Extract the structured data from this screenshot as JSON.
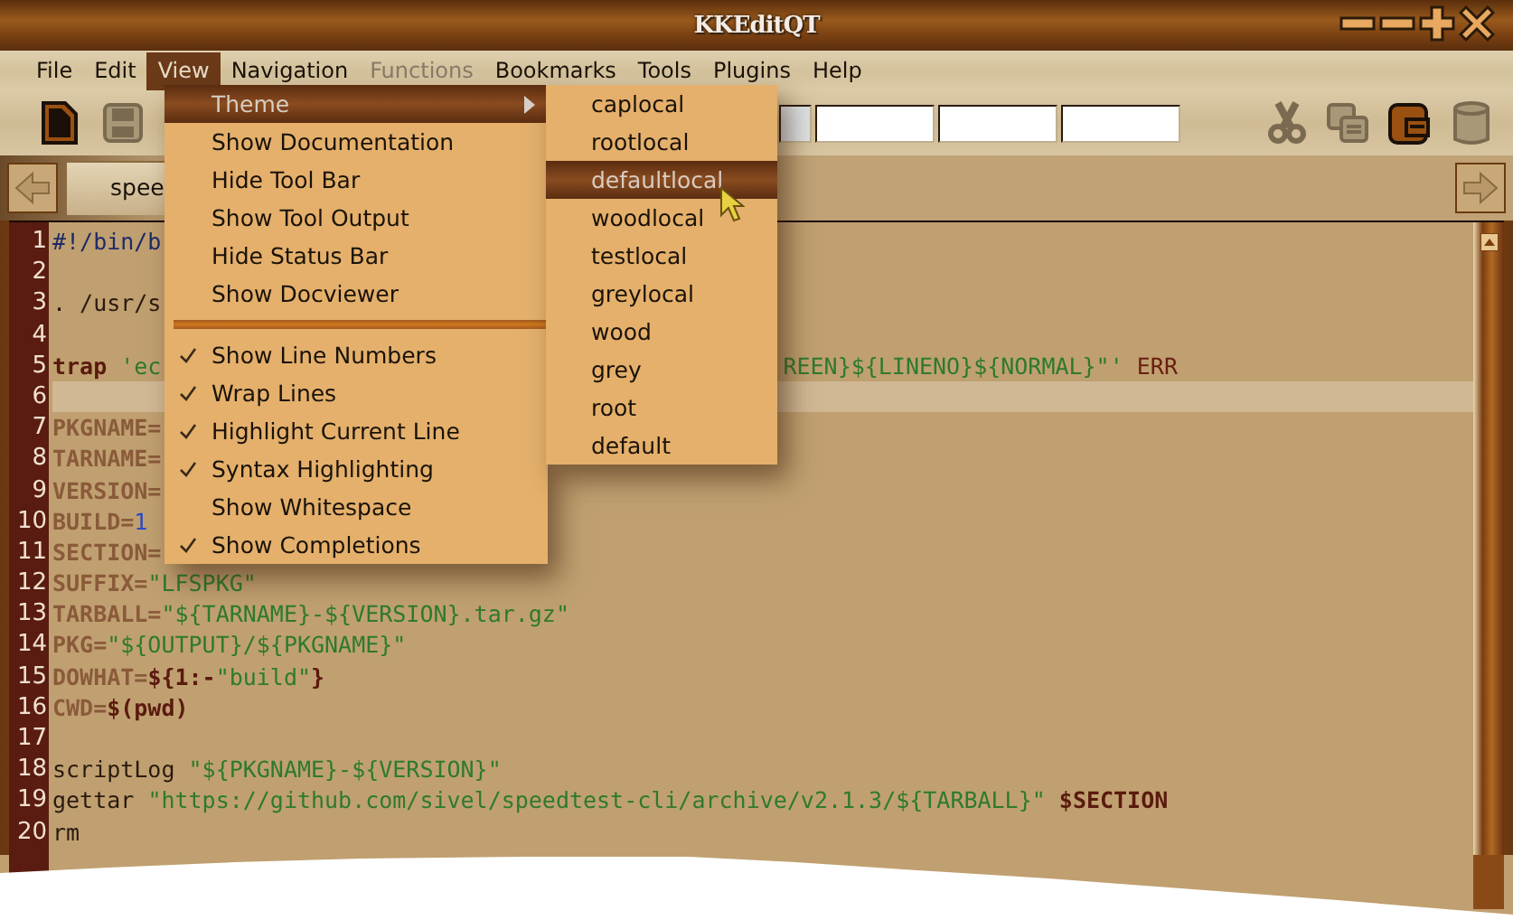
{
  "window": {
    "title": "KKEditQT"
  },
  "menubar": [
    {
      "label": "File",
      "selected": false,
      "disabled": false
    },
    {
      "label": "Edit",
      "selected": false,
      "disabled": false
    },
    {
      "label": "View",
      "selected": true,
      "disabled": false
    },
    {
      "label": "Navigation",
      "selected": false,
      "disabled": false
    },
    {
      "label": "Functions",
      "selected": false,
      "disabled": true
    },
    {
      "label": "Bookmarks",
      "selected": false,
      "disabled": false
    },
    {
      "label": "Tools",
      "selected": false,
      "disabled": false
    },
    {
      "label": "Plugins",
      "selected": false,
      "disabled": false
    },
    {
      "label": "Help",
      "selected": false,
      "disabled": false
    }
  ],
  "toolbar_left": [
    {
      "kind": "new",
      "disabled": false
    },
    {
      "kind": "save",
      "disabled": true
    }
  ],
  "toolbar_right": [
    {
      "kind": "cut",
      "disabled": true
    },
    {
      "kind": "copy",
      "disabled": true
    },
    {
      "kind": "paste",
      "disabled": false
    },
    {
      "kind": "delete",
      "disabled": true
    }
  ],
  "tabs": [
    {
      "label": "spee",
      "selected": true
    }
  ],
  "editor": {
    "lines": [
      {
        "number": "1",
        "current": false,
        "segments": [
          [
            {
              "kind": "comment",
              "text": "#!/bin/b"
            }
          ]
        ]
      },
      {
        "number": "2",
        "current": false
      },
      {
        "number": "3",
        "current": false,
        "segments": [
          [
            {
              "kind": "plain",
              "text": ". /usr/s"
            }
          ]
        ]
      },
      {
        "number": "4",
        "current": false
      },
      {
        "number": "5",
        "current": false,
        "segments": [
          [
            {
              "kind": "keyword",
              "text": "trap"
            },
            {
              "kind": "string",
              "text": " 'ec"
            }
          ],
          [
            {
              "kind": "string",
              "text": "REEN}${LINENO}${NORMAL}\"'"
            },
            {
              "kind": "word",
              "text": " ERR"
            }
          ]
        ]
      },
      {
        "number": "6",
        "current": true
      },
      {
        "number": "7",
        "current": false,
        "segments": [
          [
            {
              "kind": "var",
              "text": "PKGNAME="
            }
          ]
        ]
      },
      {
        "number": "8",
        "current": false,
        "segments": [
          [
            {
              "kind": "var",
              "text": "TARNAME="
            }
          ]
        ]
      },
      {
        "number": "9",
        "current": false,
        "segments": [
          [
            {
              "kind": "var",
              "text": "VERSION="
            }
          ]
        ]
      },
      {
        "number": "10",
        "current": false,
        "segments": [
          [
            {
              "kind": "var",
              "text": "BUILD="
            },
            {
              "kind": "number",
              "text": "1"
            }
          ]
        ]
      },
      {
        "number": "11",
        "current": false,
        "segments": [
          [
            {
              "kind": "var",
              "text": "SECTION="
            }
          ]
        ]
      },
      {
        "number": "12",
        "current": false,
        "segments": [
          [
            {
              "kind": "var",
              "text": "SUFFIX="
            },
            {
              "kind": "string",
              "text": "\"LFSPKG\""
            }
          ]
        ]
      },
      {
        "number": "13",
        "current": false,
        "segments": [
          [
            {
              "kind": "var",
              "text": "TARBALL="
            },
            {
              "kind": "string",
              "text": "\"${TARNAME}-${VERSION}.tar.gz\""
            }
          ]
        ]
      },
      {
        "number": "14",
        "current": false,
        "segments": [
          [
            {
              "kind": "var",
              "text": "PKG="
            },
            {
              "kind": "string",
              "text": "\"${OUTPUT}/${PKGNAME}\""
            }
          ]
        ]
      },
      {
        "number": "15",
        "current": false,
        "segments": [
          [
            {
              "kind": "var",
              "text": "DOWHAT="
            },
            {
              "kind": "keyword",
              "text": "${1:-"
            },
            {
              "kind": "string",
              "text": "\"build\""
            },
            {
              "kind": "keyword",
              "text": "}"
            }
          ]
        ]
      },
      {
        "number": "16",
        "current": false,
        "segments": [
          [
            {
              "kind": "var",
              "text": "CWD="
            },
            {
              "kind": "keyword",
              "text": "$(pwd)"
            }
          ]
        ]
      },
      {
        "number": "17",
        "current": false
      },
      {
        "number": "18",
        "current": false,
        "segments": [
          [
            {
              "kind": "plain",
              "text": "scriptLog "
            },
            {
              "kind": "string",
              "text": "\"${PKGNAME}-${VERSION}\""
            }
          ]
        ]
      },
      {
        "number": "19",
        "current": false,
        "segments": [
          [
            {
              "kind": "plain",
              "text": "gettar "
            },
            {
              "kind": "string",
              "text": "\"https://github.com/sivel/speedtest-cli/archive/v2.1.3/${TARBALL}\""
            },
            {
              "kind": "keyword",
              "text": " $SECTION"
            }
          ]
        ]
      },
      {
        "number": "20",
        "current": false,
        "segments": [
          [
            {
              "kind": "plain",
              "text": "rm"
            }
          ]
        ]
      }
    ]
  },
  "view_menu": [
    {
      "kind": "submenu",
      "label": "Theme",
      "selected": true
    },
    {
      "kind": "item",
      "label": "Show Documentation",
      "checked": false,
      "selected": false
    },
    {
      "kind": "item",
      "label": "Hide Tool Bar",
      "checked": false,
      "selected": false
    },
    {
      "kind": "item",
      "label": "Show Tool Output",
      "checked": false,
      "selected": false
    },
    {
      "kind": "item",
      "label": "Hide Status Bar",
      "checked": false,
      "selected": false
    },
    {
      "kind": "item",
      "label": "Show Docviewer",
      "checked": false,
      "selected": false
    },
    {
      "kind": "separator"
    },
    {
      "kind": "item",
      "label": "Show Line Numbers",
      "checked": true,
      "selected": false
    },
    {
      "kind": "item",
      "label": "Wrap Lines",
      "checked": true,
      "selected": false
    },
    {
      "kind": "item",
      "label": "Highlight Current Line",
      "checked": true,
      "selected": false
    },
    {
      "kind": "item",
      "label": "Syntax Highlighting",
      "checked": true,
      "selected": false
    },
    {
      "kind": "item",
      "label": "Show Whitespace",
      "checked": false,
      "selected": false
    },
    {
      "kind": "item",
      "label": "Show Completions",
      "checked": true,
      "selected": false
    }
  ],
  "theme_menu": [
    {
      "label": "caplocal",
      "selected": false
    },
    {
      "label": "rootlocal",
      "selected": false
    },
    {
      "label": "defaultlocal",
      "selected": true
    },
    {
      "label": "woodlocal",
      "selected": false
    },
    {
      "label": "testlocal",
      "selected": false
    },
    {
      "label": "greylocal",
      "selected": false
    },
    {
      "label": "wood",
      "selected": false
    },
    {
      "label": "grey",
      "selected": false
    },
    {
      "label": "root",
      "selected": false
    },
    {
      "label": "default",
      "selected": false
    }
  ]
}
